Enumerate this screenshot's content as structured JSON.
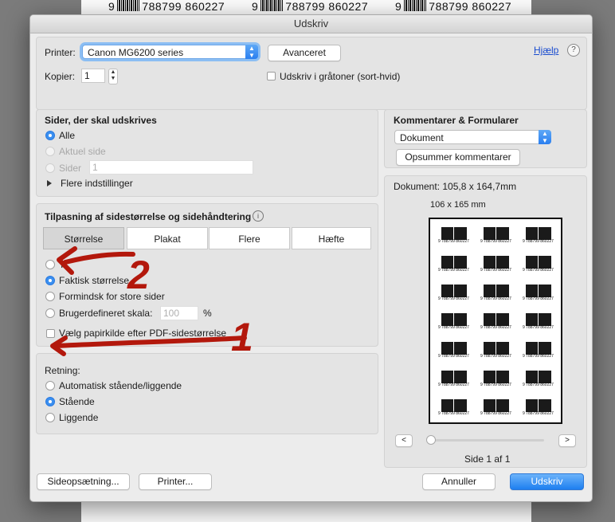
{
  "background": {
    "barcodes": [
      {
        "prefix": "9",
        "digits": "788799",
        "suffix": "860227"
      },
      {
        "prefix": "9",
        "digits": "788799",
        "suffix": "860227"
      },
      {
        "prefix": "9",
        "digits": "788799",
        "suffix": "860227"
      }
    ]
  },
  "dialog": {
    "title": "Udskriv",
    "printer": {
      "label": "Printer:",
      "value": "Canon MG6200 series",
      "advanced_button": "Avanceret",
      "help_link": "Hjælp",
      "help_icon": "?"
    },
    "copies": {
      "label": "Kopier:",
      "value": "1"
    },
    "grayscale": {
      "label": "Udskriv i gråtoner (sort-hvid)",
      "checked": false
    },
    "pages": {
      "heading": "Sider, der skal udskrives",
      "options": [
        {
          "label": "Alle",
          "selected": true,
          "enabled": true
        },
        {
          "label": "Aktuel side",
          "selected": false,
          "enabled": false
        },
        {
          "label": "Sider",
          "selected": false,
          "enabled": false
        }
      ],
      "pages_field": "1",
      "more_settings": "Flere indstillinger"
    },
    "sizing": {
      "heading": "Tilpasning af sidestørrelse og sidehåndtering",
      "info_icon": "i",
      "tabs": [
        "Størrelse",
        "Plakat",
        "Flere",
        "Hæfte"
      ],
      "active_tab": 0,
      "options": [
        {
          "label": "T",
          "selected": false
        },
        {
          "label": "Faktisk størrelse",
          "selected": true
        },
        {
          "label": "Formindsk for store sider",
          "selected": false
        },
        {
          "label": "Brugerdefineret skala:",
          "selected": false
        }
      ],
      "scale_value": "100",
      "scale_unit": "%",
      "paper_source": {
        "label": "Vælg papirkilde efter PDF-sidestørrelse",
        "checked": false
      }
    },
    "orientation": {
      "heading": "Retning:",
      "options": [
        {
          "label": "Automatisk stående/liggende",
          "selected": false
        },
        {
          "label": "Stående",
          "selected": true
        },
        {
          "label": "Liggende",
          "selected": false
        }
      ]
    },
    "comments": {
      "heading": "Kommentarer & Formularer",
      "select_value": "Dokument",
      "summarize_button": "Opsummer kommentarer"
    },
    "preview": {
      "document_size": "Dokument: 105,8 x 164,7mm",
      "page_size": "106 x 165 mm",
      "label_text": "9 788799 860227",
      "prev_button": "<",
      "next_button": ">",
      "page_indicator": "Side 1 af 1",
      "slider_value": 0
    },
    "footer": {
      "page_setup_button": "Sideopsætning...",
      "printer_button": "Printer...",
      "cancel_button": "Annuller",
      "print_button": "Udskriv"
    },
    "annotations": {
      "first": "1",
      "second": "2"
    }
  },
  "colors": {
    "accent": "#1e7ff0",
    "annotation": "#b3180c"
  }
}
